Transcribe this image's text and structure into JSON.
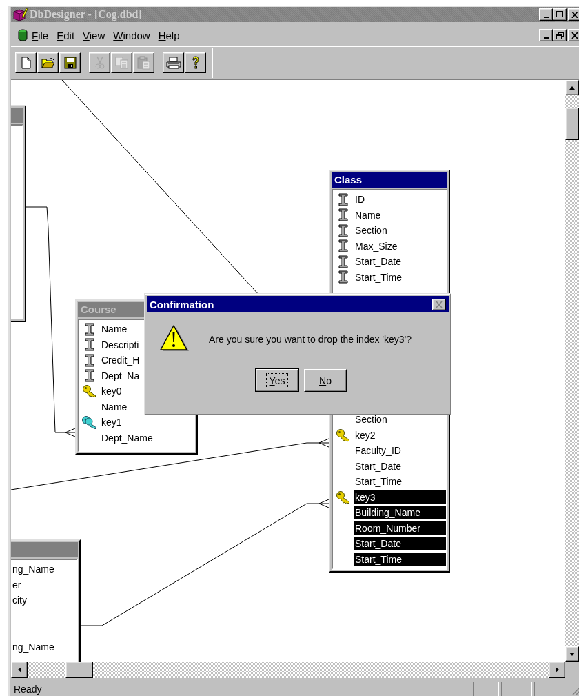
{
  "window": {
    "title": "DbDesigner - [Cog.dbd]",
    "active": false
  },
  "menu": [
    "File",
    "Edit",
    "View",
    "Window",
    "Help"
  ],
  "toolbar_groups": [
    [
      {
        "kind": "new",
        "disabled": false
      },
      {
        "kind": "open",
        "disabled": false
      },
      {
        "kind": "save",
        "disabled": false
      }
    ],
    [
      {
        "kind": "cut",
        "disabled": true
      },
      {
        "kind": "copy",
        "disabled": true
      },
      {
        "kind": "paste",
        "disabled": true
      }
    ],
    [
      {
        "kind": "print",
        "disabled": false
      },
      {
        "kind": "help",
        "disabled": false
      }
    ]
  ],
  "tables": [
    {
      "selected": false
    },
    {
      "title": "Course",
      "selected": false,
      "rows": [
        {
          "kind": "column",
          "text": "Name",
          "selected": false
        },
        {
          "kind": "column",
          "text": "Descripti",
          "selected": false
        },
        {
          "kind": "column",
          "text": "Credit_H",
          "selected": false
        },
        {
          "kind": "column",
          "text": "Dept_Na",
          "selected": false
        },
        {
          "kind": "index",
          "text": "key0",
          "selected": false
        },
        {
          "kind": "member",
          "text": "Name",
          "selected": false
        },
        {
          "kind": "foreign_index",
          "text": "key1",
          "selected": false
        },
        {
          "kind": "member",
          "text": "Dept_Name",
          "selected": false
        }
      ]
    },
    {
      "title": "Class",
      "selected": true,
      "rows": [
        {
          "kind": "column",
          "text": "ID",
          "selected": false
        },
        {
          "kind": "column",
          "text": "Name",
          "selected": false
        },
        {
          "kind": "column",
          "text": "Section",
          "selected": false
        },
        {
          "kind": "column",
          "text": "Max_Size",
          "selected": false
        },
        {
          "kind": "column",
          "text": "Start_Date",
          "selected": false
        },
        {
          "kind": "column",
          "text": "Start_Time",
          "selected": false
        }
      ],
      "rows_lower": [
        {
          "kind": "member",
          "text": "Section",
          "selected": false
        },
        {
          "kind": "index",
          "text": "key2",
          "selected": false
        },
        {
          "kind": "member",
          "text": "Faculty_ID",
          "selected": false
        },
        {
          "kind": "member",
          "text": "Start_Date",
          "selected": false
        },
        {
          "kind": "member",
          "text": "Start_Time",
          "selected": false
        },
        {
          "kind": "index",
          "text": "key3",
          "selected": true
        },
        {
          "kind": "member",
          "text": "Building_Name",
          "selected": true
        },
        {
          "kind": "member",
          "text": "Room_Number",
          "selected": true
        },
        {
          "kind": "member",
          "text": "Start_Date",
          "selected": true
        },
        {
          "kind": "member",
          "text": "Start_Time",
          "selected": true
        }
      ]
    },
    {
      "selected": false,
      "rows": [
        {
          "kind": "member",
          "text": "ng_Name",
          "selected": false
        },
        {
          "kind": "member",
          "text": "er",
          "selected": false
        },
        {
          "kind": "member",
          "text": "city",
          "selected": false
        },
        {
          "kind": "blank"
        },
        {
          "kind": "blank"
        },
        {
          "kind": "member",
          "text": "ng_Name",
          "selected": false
        }
      ]
    }
  ],
  "dialog": {
    "title": "Confirmation",
    "active": true,
    "message": "Are you sure you want to drop the index 'key3'?",
    "buttons": [
      {
        "label": "Yes",
        "default": true
      },
      {
        "label": "No",
        "default": false
      }
    ]
  },
  "status_bar": {
    "text": "Ready"
  }
}
